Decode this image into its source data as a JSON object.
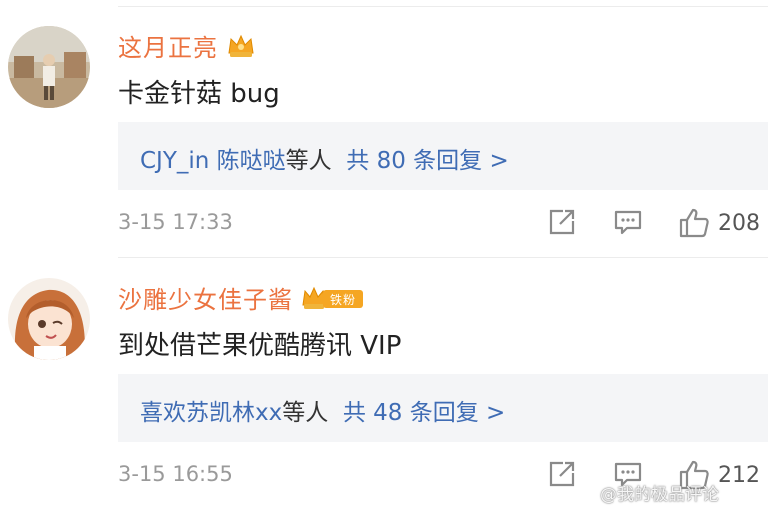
{
  "comments": [
    {
      "username": "这月正亮",
      "text": "卡金针菇 bug",
      "reply_users": "CJY_in 陈哒哒",
      "reply_suffix": "等人",
      "reply_count_label": "共 80 条回复 >",
      "time": "3-15 17:33",
      "likes": "208",
      "badge_icon": "crown-badge-icon"
    },
    {
      "username": "沙雕少女佳子酱",
      "text": "到处借芒果优酷腾讯 VIP",
      "reply_users": "喜欢苏凯林xx",
      "reply_suffix": "等人",
      "reply_count_label": "共 48 条回复 >",
      "time": "3-15 16:55",
      "likes": "212",
      "badge_icon": "crown-badge-icon",
      "badge_text": "铁粉"
    }
  ],
  "watermark": "@我的极品评论",
  "colors": {
    "username": "#eb7340",
    "reply_link": "#3f6cb4",
    "reply_bg": "#f4f5f7",
    "meta": "#9a9a9a"
  }
}
